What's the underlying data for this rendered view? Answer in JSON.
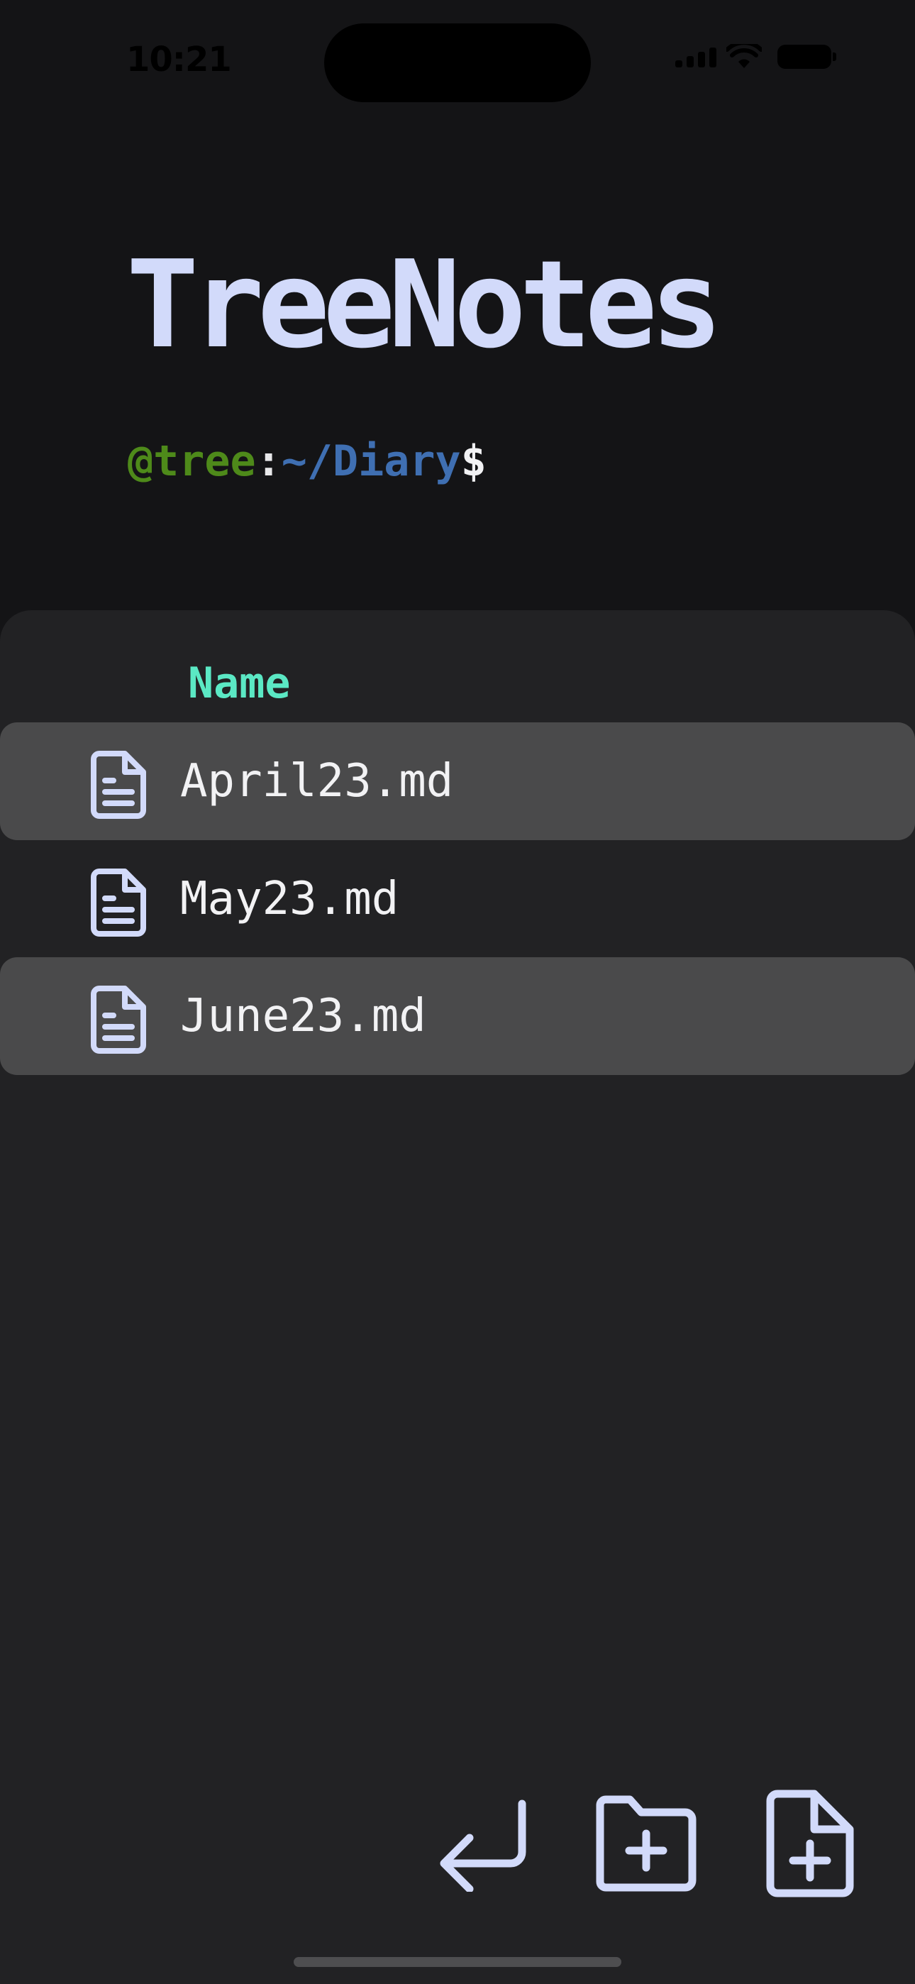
{
  "status_bar": {
    "time": "10:21"
  },
  "header": {
    "title": "TreeNotes",
    "prompt": {
      "user": "@tree",
      "separator": ":",
      "path": "~/Diary",
      "symbol": "$"
    }
  },
  "file_list": {
    "column_header": "Name",
    "items": [
      {
        "name": "April23.md",
        "icon": "document-icon"
      },
      {
        "name": "May23.md",
        "icon": "document-icon"
      },
      {
        "name": "June23.md",
        "icon": "document-icon"
      }
    ]
  },
  "actions": [
    {
      "icon": "return-arrow-icon"
    },
    {
      "icon": "new-folder-icon"
    },
    {
      "icon": "new-file-icon"
    }
  ],
  "colors": {
    "background": "#141416",
    "panel": "#222224",
    "row_highlight": "#4a4a4b",
    "title": "#d2dafa",
    "column_header": "#5be8c4",
    "prompt_user": "#4e8a1a",
    "prompt_path": "#3f6fb2",
    "icon": "#d2dafa"
  }
}
